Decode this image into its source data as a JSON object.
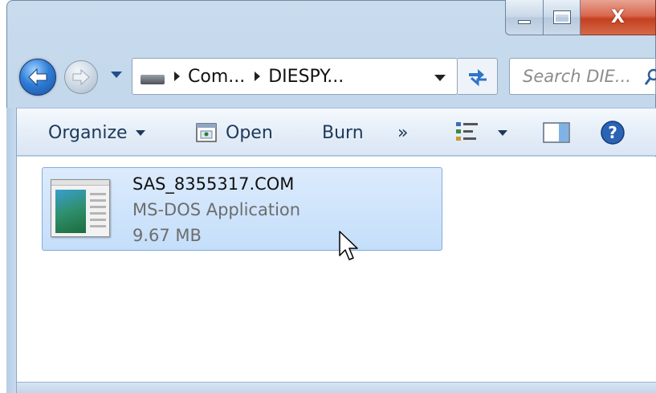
{
  "window": {
    "caption_buttons": {
      "minimize": "minimize-icon",
      "maximize": "maximize-icon",
      "close": "close-icon"
    },
    "close_glyph": "X"
  },
  "nav": {
    "back_icon": "back-arrow-icon",
    "forward_icon": "forward-arrow-icon",
    "address": {
      "drive_icon": "drive-icon",
      "crumbs": [
        "Com...",
        "DIESPY..."
      ]
    },
    "refresh_icon": "refresh-icon",
    "search": {
      "placeholder": "Search DIE...",
      "icon": "magnifier-icon"
    }
  },
  "toolbar": {
    "organize_label": "Organize",
    "open_label": "Open",
    "burn_label": "Burn",
    "more_label": "»",
    "views_icon": "views-icon",
    "preview_pane_icon": "preview-pane-icon",
    "help_label": "?"
  },
  "files": [
    {
      "name": "SAS_8355317.COM",
      "type": "MS-DOS Application",
      "size": "9.67 MB",
      "selected": true
    }
  ],
  "colors": {
    "accent": "#2f7ed8",
    "selection": "#c4defa",
    "close_button": "#c4401f"
  }
}
